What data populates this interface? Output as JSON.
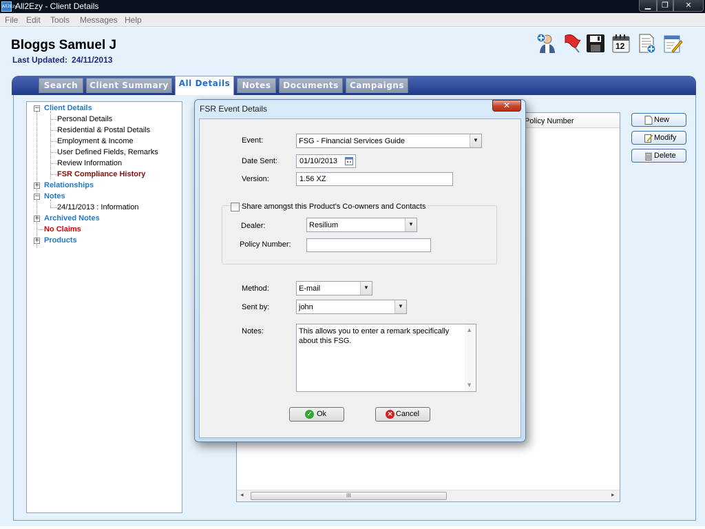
{
  "window": {
    "logo_text": "All2Ezy",
    "title": "All2Ezy - Client Details",
    "minimize": "▁",
    "maximize": "❐",
    "close": "✕"
  },
  "menu": [
    "File",
    "Edit",
    "Tools",
    "Messages",
    "Help"
  ],
  "client": {
    "name": "Bloggs Samuel J",
    "last_updated_label": "Last Updated:",
    "last_updated_value": "24/11/2013"
  },
  "toolbar_icons": [
    "add-user-icon",
    "flag-icon",
    "save-icon",
    "calendar-icon",
    "new-document-icon",
    "edit-note-icon"
  ],
  "calendar_day": "12",
  "tabs": [
    {
      "label": "Search",
      "active": false
    },
    {
      "label": "Client Summary",
      "active": false
    },
    {
      "label": "All Details",
      "active": true
    },
    {
      "label": "Notes",
      "active": false
    },
    {
      "label": "Documents",
      "active": false
    },
    {
      "label": "Campaigns",
      "active": false
    }
  ],
  "tree": {
    "expanded_glyph": "−",
    "collapsed_glyph": "+",
    "nodes": [
      {
        "label": "Client Details",
        "expanded": true
      },
      {
        "label": "Personal Details"
      },
      {
        "label": "Residential & Postal Details"
      },
      {
        "label": "Employment & Income"
      },
      {
        "label": "User Defined Fields, Remarks"
      },
      {
        "label": "Review Information"
      },
      {
        "label": "FSR Compliance History"
      },
      {
        "label": "Relationships",
        "expanded": false
      },
      {
        "label": "Notes",
        "expanded": true
      },
      {
        "label": "24/11/2013 : Information"
      },
      {
        "label": "Archived Notes",
        "expanded": false
      },
      {
        "label": "No Claims"
      },
      {
        "label": "Products",
        "expanded": false
      }
    ]
  },
  "list_panel": {
    "column_header": "Policy Number",
    "scroll_left": "◂",
    "scroll_right": "▸",
    "scroll_grip": "III"
  },
  "side_buttons": {
    "new": "New",
    "modify": "Modify",
    "delete": "Delete"
  },
  "dialog": {
    "title": "FSR Event Details",
    "close": "✕",
    "dropdown_glyph": "▼",
    "event_label": "Event:",
    "event_value": "FSG - Financial Services Guide",
    "date_sent_label": "Date Sent:",
    "date_sent_value": "01/10/2013",
    "version_label": "Version:",
    "version_value": "1.56 XZ",
    "share_label": "Share amongst this Product's Co-owners and Contacts",
    "share_checked": false,
    "dealer_label": "Dealer:",
    "dealer_value": "Resilium",
    "policy_number_label": "Policy Number:",
    "policy_number_value": "",
    "method_label": "Method:",
    "method_value": "E-mail",
    "sent_by_label": "Sent by:",
    "sent_by_value": "john",
    "notes_label": "Notes:",
    "notes_value": "This allows you to enter a remark specifically about this FSG.",
    "notes_scroll_up": "▲",
    "notes_scroll_down": "▼",
    "ok_label": "Ok",
    "ok_glyph": "✓",
    "cancel_label": "Cancel",
    "cancel_glyph": "✕"
  },
  "colors": {
    "accent_blue": "#1e7ad2",
    "tab_strip": "#2a4896",
    "dialog_frame": "#c5ddf1",
    "compliance_red": "#8c0a0a",
    "no_claims_red": "#e00000"
  }
}
